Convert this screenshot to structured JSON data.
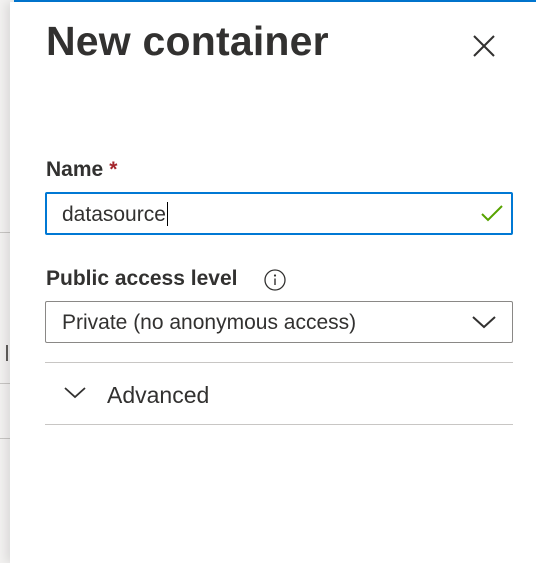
{
  "panel": {
    "title": "New container"
  },
  "name_field": {
    "label": "Name",
    "required_marker": "*",
    "value": "datasource",
    "validation_icon": "check-icon",
    "is_valid": true
  },
  "access_field": {
    "label": "Public access level",
    "info_icon": "info-icon",
    "selected": "Private (no anonymous access)"
  },
  "advanced": {
    "label": "Advanced",
    "expanded": false,
    "icon": "chevron-down-icon"
  },
  "colors": {
    "accent": "#0078d4",
    "required": "#a4262c",
    "valid": "#57a300",
    "text": "#323130"
  }
}
